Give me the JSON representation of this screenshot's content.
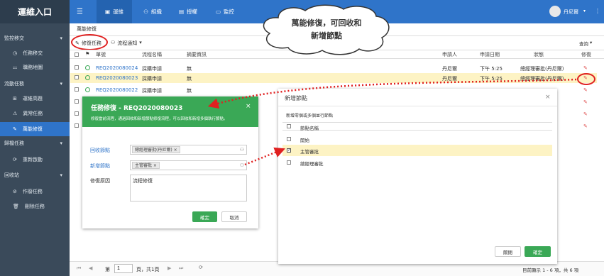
{
  "brand": "運維入口",
  "topnav": {
    "tabs": [
      "運維",
      "組織",
      "授權",
      "監控"
    ],
    "user": "丹尼爾"
  },
  "sidebar": {
    "groups": [
      {
        "label": "監控移交",
        "items": [
          "任務移交",
          "職務地圖"
        ]
      },
      {
        "label": "流動任務",
        "items": [
          "運維高題",
          "異常任務",
          "萬能修復"
        ]
      },
      {
        "label": "歸檔任務",
        "items": [
          "重新啟動"
        ]
      },
      {
        "label": "回收站",
        "items": [
          "作廢任務",
          "刪除任務"
        ]
      }
    ]
  },
  "breadcrumb": "萬能修復",
  "toolbar": {
    "repair": "修復任務",
    "notify": "流程通知",
    "search": "查詢"
  },
  "table": {
    "headers": [
      "單號",
      "流程名稱",
      "摘要資訊",
      "申請人",
      "申請日期",
      "狀態",
      "修復"
    ],
    "rows": [
      {
        "id": "REQ2020080024",
        "flow": "採購申請",
        "summary": "無",
        "applicant": "丹尼爾",
        "date": "下午 5:25",
        "status": "總經理審批(丹尼爾)"
      },
      {
        "id": "REQ2020080023",
        "flow": "採購申請",
        "summary": "無",
        "applicant": "丹尼爾",
        "date": "下午 5:25",
        "status": "總經理審批(丹尼爾)"
      },
      {
        "id": "REQ2020080022",
        "flow": "採購申請",
        "summary": "無",
        "applicant": "",
        "date": "",
        "status": ""
      },
      {
        "id": "",
        "flow": "",
        "summary": "",
        "applicant": "",
        "date": "",
        "status": ""
      },
      {
        "id": "",
        "flow": "",
        "summary": "",
        "applicant": "",
        "date": "",
        "status": ""
      },
      {
        "id": "",
        "flow": "",
        "summary": "",
        "applicant": "",
        "date": "",
        "status": ""
      }
    ]
  },
  "pager": {
    "page_label": "第",
    "page": "1",
    "of": "頁，共1頁",
    "summary": "目前顯示 1 - 6 項，共 6 項"
  },
  "callout": {
    "line1": "萬能修復，可回收和",
    "line2": "新增節點"
  },
  "dialog_repair": {
    "title": "任務修復 - REQ2020080023",
    "desc": "修復當前流程，通過回收和新增節點修復流程，可以回收和新增多個執行節點。",
    "recycle_label": "回收節點",
    "recycle_value": "總經理審批(丹尼爾)",
    "add_label": "新增節點",
    "add_value": "主管審批",
    "reason_label": "修復原因",
    "reason_value": "流程修復",
    "ok": "確定",
    "cancel": "取消"
  },
  "dialog_add": {
    "title": "新增節點",
    "hint": "新增零個或多個並行節點",
    "col": "節點名稱",
    "nodes": [
      "開始",
      "主管審批",
      "總經理審批"
    ],
    "selected": 1,
    "close": "關閉",
    "ok": "確定"
  },
  "colors": {
    "primary": "#2f74c9",
    "green": "#3aa856",
    "sidebar": "#3a4a5a",
    "highlight": "#fdf3c4"
  }
}
